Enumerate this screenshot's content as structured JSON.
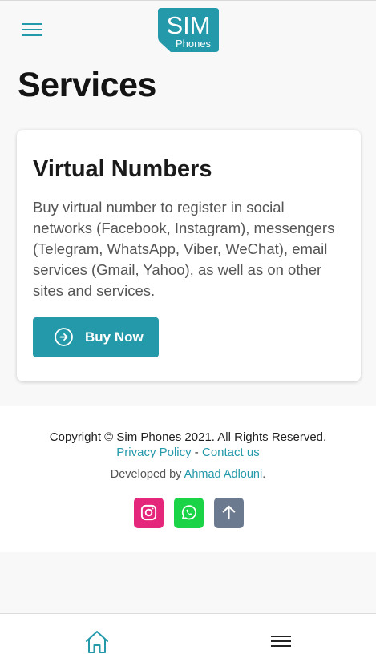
{
  "header": {
    "logo_text_main": "SIM",
    "logo_text_sub": "Phones",
    "menu_icon": "hamburger-menu-icon",
    "accent_color": "#2399a9"
  },
  "page": {
    "title": "Services"
  },
  "service_card": {
    "title": "Virtual Numbers",
    "description": "Buy virtual number to register in social networks (Facebook, Instagram), messengers (Telegram, WhatsApp, Viber, WeChat), email services (Gmail, Yahoo), as well as on other sites and services.",
    "button_label": "Buy Now",
    "button_icon": "arrow-right-circle-icon",
    "button_color": "#2399a9"
  },
  "footer": {
    "copyright": "Copyright © Sim Phones 2021. All Rights Reserved.",
    "privacy_link": "Privacy Policy",
    "separator": " - ",
    "contact_link": "Contact us",
    "developed_by_prefix": "Developed by ",
    "developer_name": "Ahmad Adlouni",
    "developed_by_suffix": ".",
    "social": [
      {
        "icon": "instagram-icon",
        "color": "#e4277b"
      },
      {
        "icon": "whatsapp-icon",
        "color": "#1bd346"
      },
      {
        "icon": "arrow-up-icon",
        "color": "#6c7a8f"
      }
    ]
  },
  "bottom_nav": {
    "home_icon": "home-icon",
    "menu_icon": "hamburger-menu-icon"
  }
}
